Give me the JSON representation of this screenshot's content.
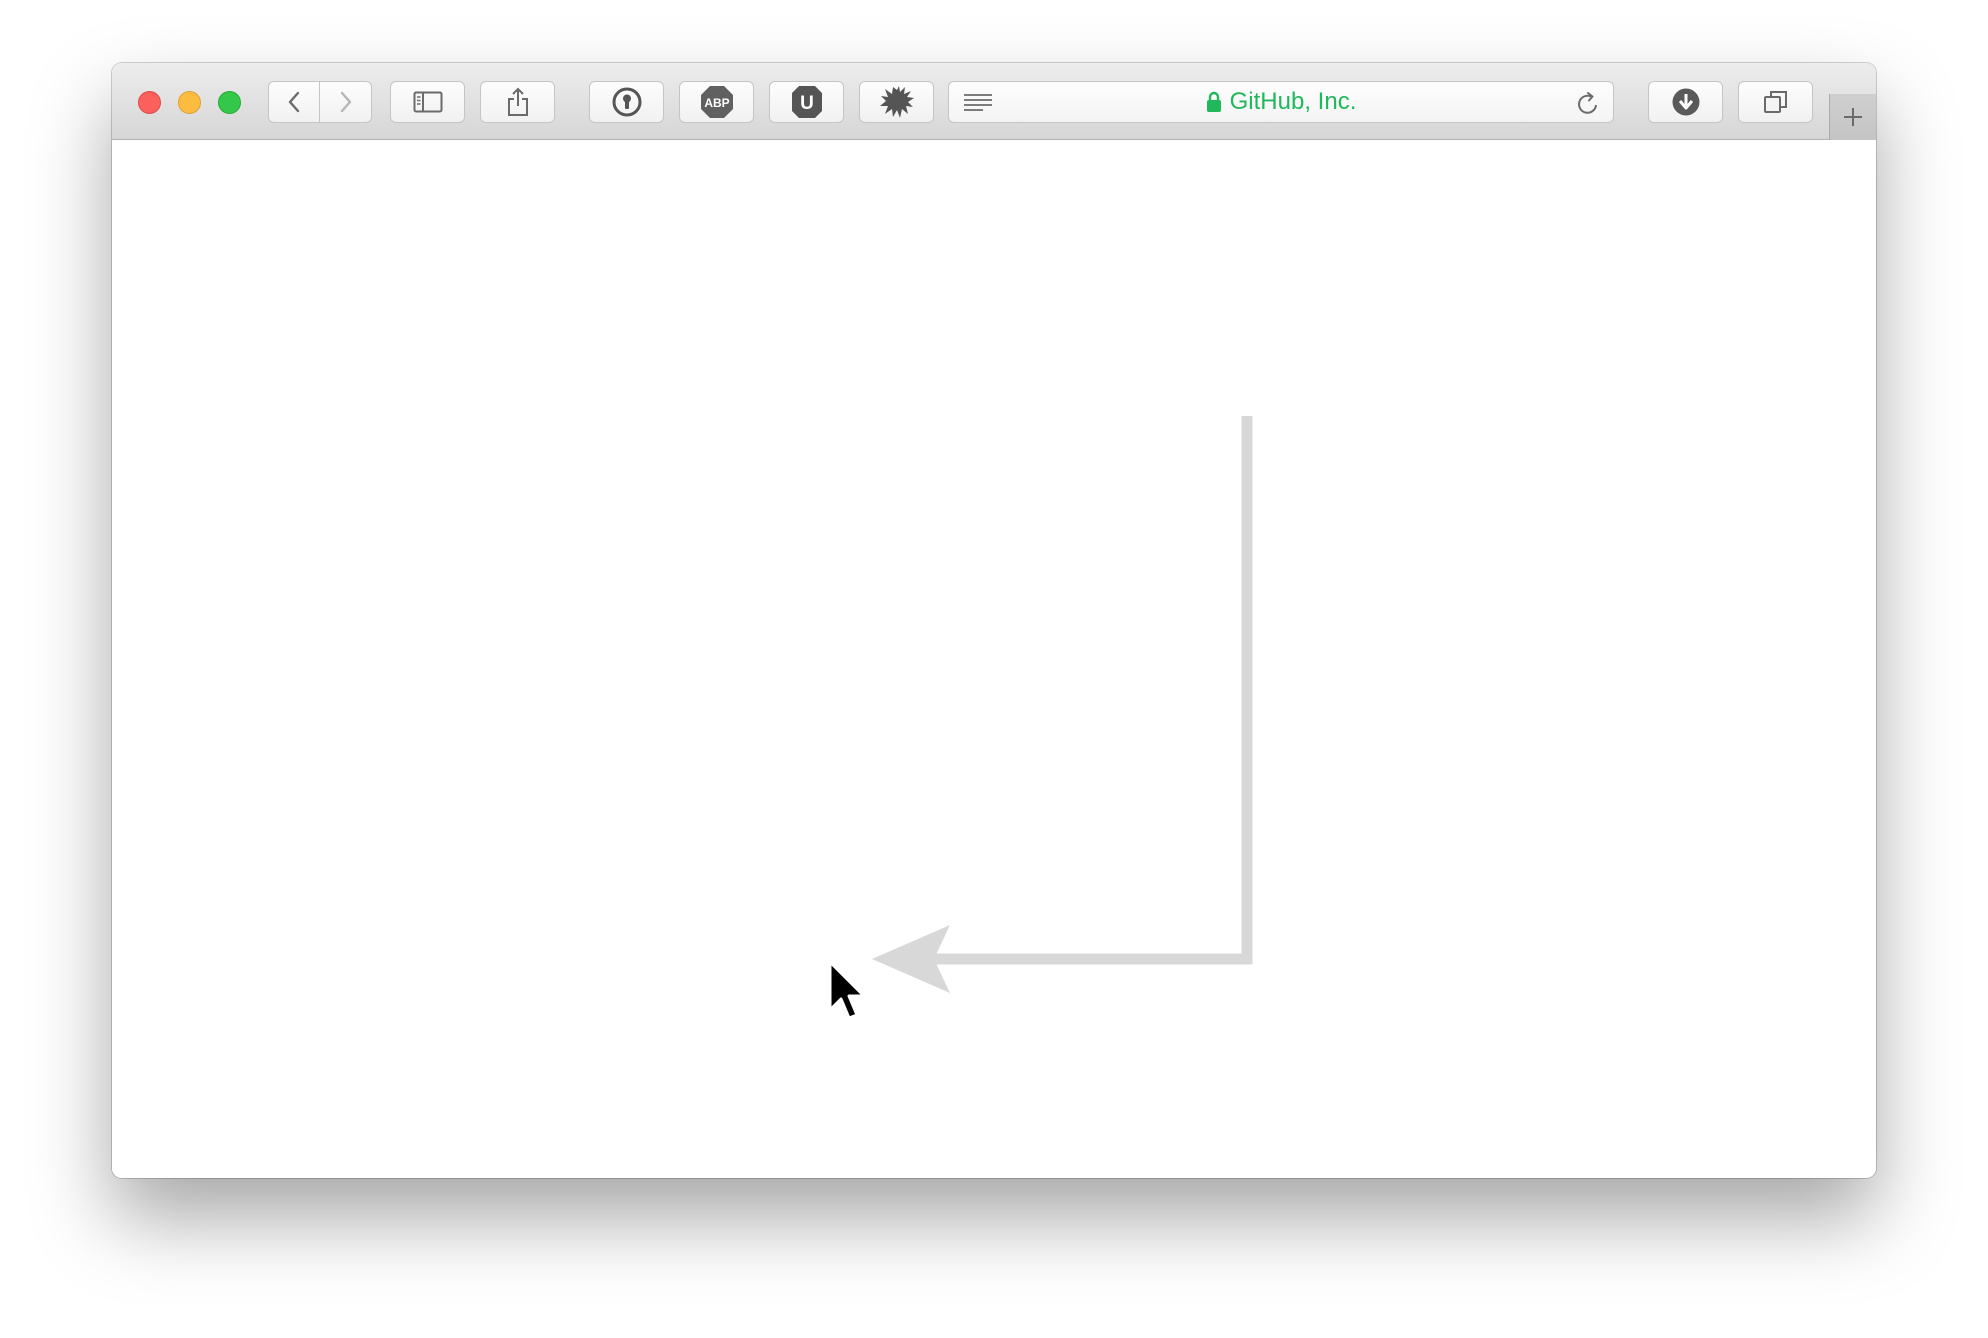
{
  "window": {
    "address_bar": {
      "site_name": "GitHub, Inc.",
      "secure": true,
      "accent_color": "#1fb85b"
    },
    "toolbar": {
      "buttons": [
        {
          "icon": "back-arrow-icon"
        },
        {
          "icon": "forward-arrow-icon"
        },
        {
          "icon": "sidebar-icon"
        },
        {
          "icon": "share-icon"
        },
        {
          "icon": "1password-icon"
        },
        {
          "icon": "adblock-plus-icon",
          "label": "ABP"
        },
        {
          "icon": "ublock-icon",
          "label": "U"
        },
        {
          "icon": "splat-extension-icon"
        },
        {
          "icon": "downloads-icon"
        },
        {
          "icon": "tab-overview-icon"
        }
      ],
      "new_tab_icon": "plus-icon"
    },
    "traffic_lights": {
      "close": "#fc605c",
      "minimize": "#fdbc40",
      "maximize": "#34c84a"
    }
  },
  "content": {
    "annotation": {
      "type": "arrow",
      "color": "#d8d8d8",
      "direction": "down-then-left"
    },
    "cursor": {
      "icon": "mouse-pointer-icon"
    }
  }
}
